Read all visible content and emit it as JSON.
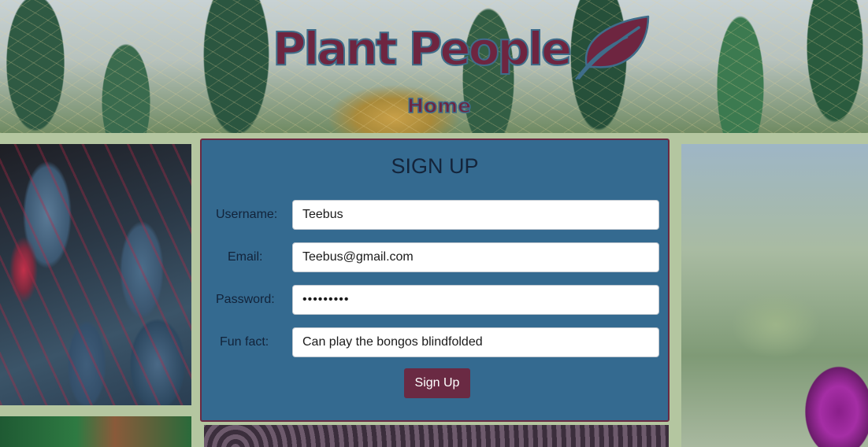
{
  "header": {
    "logo_text": "Plant People",
    "nav_home": "Home"
  },
  "signup": {
    "title": "SIGN UP",
    "fields": {
      "username": {
        "label": "Username:",
        "value": "Teebus"
      },
      "email": {
        "label": "Email:",
        "value": "Teebus@gmail.com"
      },
      "password": {
        "label": "Password:",
        "value": "•••••••••"
      },
      "fun_fact": {
        "label": "Fun fact:",
        "value": "Can play the bongos blindfolded"
      }
    },
    "submit_label": "Sign Up"
  },
  "icons": {
    "logo": "leaf-icon"
  },
  "colors": {
    "page_background": "#b4c6a0",
    "card_background": "#346a90",
    "accent_maroon": "#6a2a43",
    "logo_outline": "#3f6d8a"
  }
}
